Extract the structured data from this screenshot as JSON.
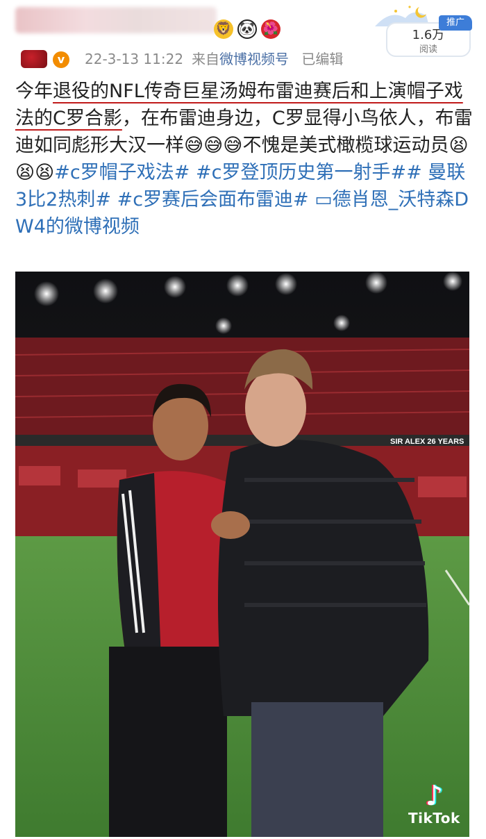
{
  "header": {
    "username_blurred": true,
    "badges": [
      {
        "icon": "lion-emoji-icon",
        "glyph": "🦁"
      },
      {
        "icon": "panda-emoji-icon",
        "glyph": "🐼"
      },
      {
        "icon": "flower-emoji-icon",
        "glyph": "🌺"
      }
    ],
    "verified_glyph": "v",
    "date": "22-3-13 11:22",
    "source_prefix": "来自",
    "source_name": "微博视频号",
    "edited": "已编辑",
    "promo_tag": "推广",
    "read_count": "1.6万",
    "read_label": "阅读"
  },
  "post": {
    "text_plain_1": "今年",
    "text_underlined_1": "退役的NFL传奇巨星汤姆布雷迪赛后和上演帽子戏法的C罗合影",
    "text_plain_2": "，在布雷迪身边，C罗显得小鸟依人，布雷迪如同彪形大汉一样",
    "emoji_group_1": "😅😅😅",
    "text_plain_3": "不愧是美式橄榄球运动员",
    "emoji_group_2": "😫😫😫",
    "hashtags": [
      "#c罗帽子戏法#",
      "#c罗登顶历史第一射手##",
      "曼联3比2热刺#",
      "#c罗赛后会面布雷迪#"
    ],
    "video_link": "德肖恩_沃特森DW4的微博视频",
    "video_link_icon": "video-play-icon"
  },
  "photo": {
    "stand_banner": "SIR ALEX 26 YEARS",
    "watermark_name": "TikTok",
    "watermark_icon": "tiktok-note-icon",
    "colors": {
      "grass": "#4e8f3a",
      "seats": "#8a1f24",
      "sky": "#141519"
    }
  }
}
